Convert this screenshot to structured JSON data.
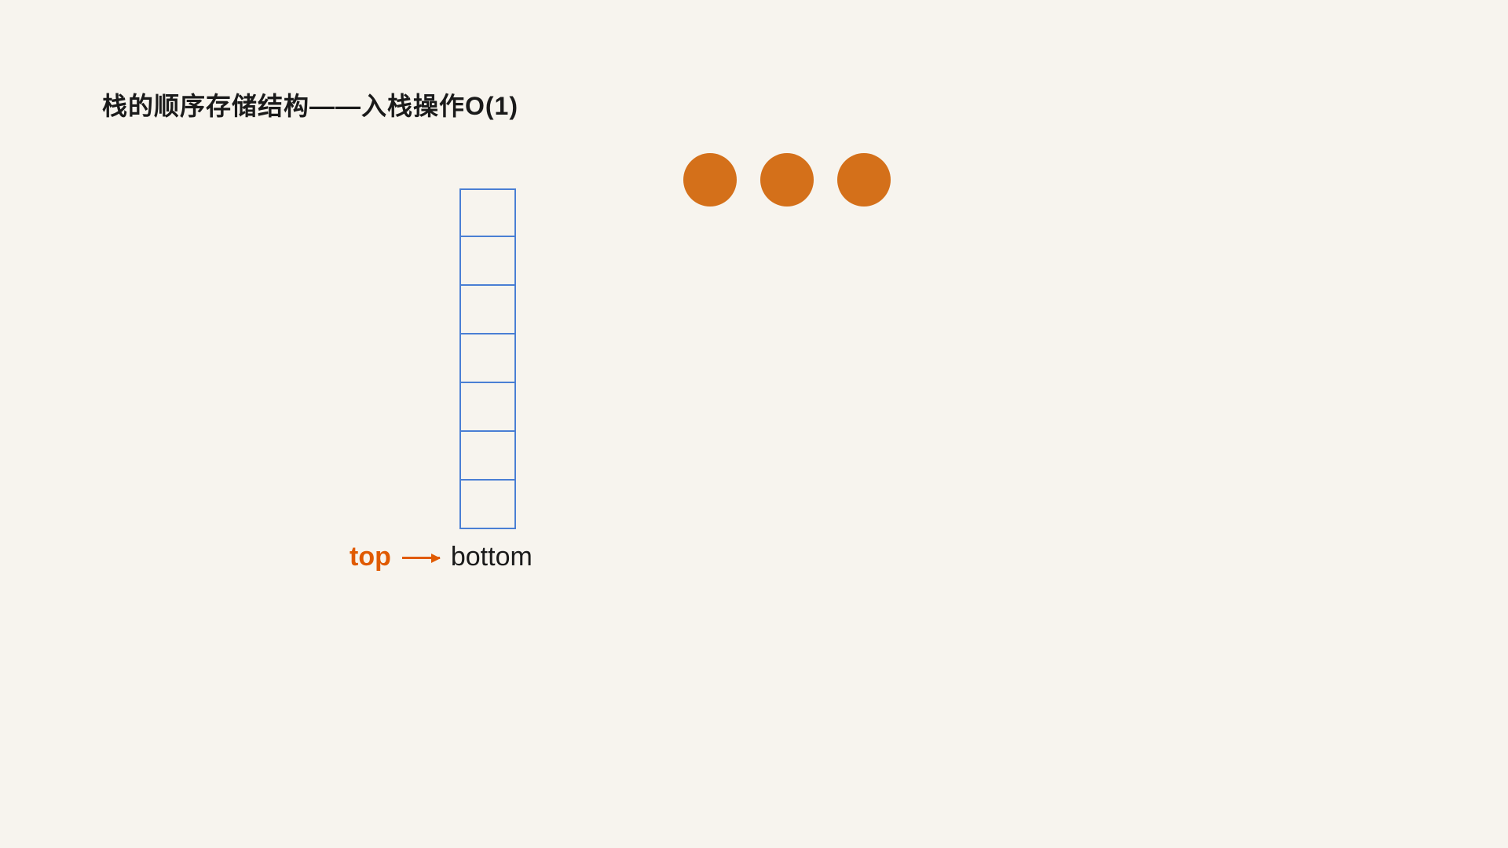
{
  "page": {
    "title": "栈的顺序存储结构——入栈操作O(1)",
    "background_color": "#f7f4ee"
  },
  "stack": {
    "cell_count": 7,
    "border_color": "#4a7fd4"
  },
  "labels": {
    "top": "top",
    "bottom": "bottom"
  },
  "circles": {
    "count": 3,
    "color": "#d4701a"
  }
}
